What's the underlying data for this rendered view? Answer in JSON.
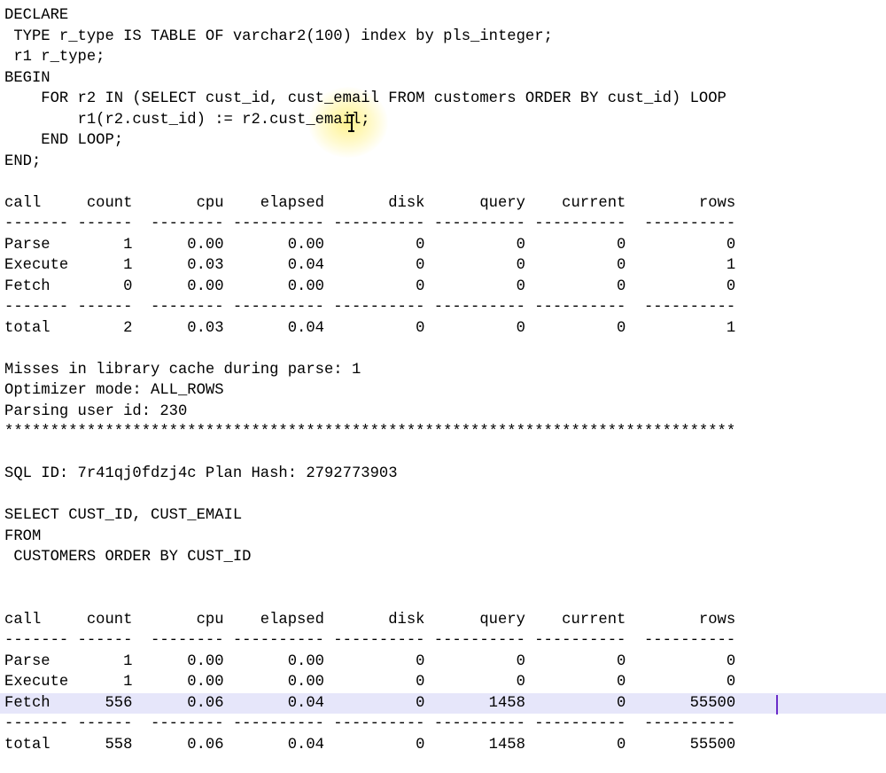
{
  "editor": {
    "lines": [
      "DECLARE",
      " TYPE r_type IS TABLE OF varchar2(100) index by pls_integer;",
      " r1 r_type;",
      "BEGIN",
      "    FOR r2 IN (SELECT cust_id, cust_email FROM customers ORDER BY cust_id) LOOP",
      "        r1(r2.cust_id) := r2.cust_email;",
      "    END LOOP;",
      "END;",
      "",
      "call     count       cpu    elapsed       disk      query    current        rows",
      "------- ------  -------- ---------- ---------- ---------- ----------  ----------",
      "Parse        1      0.00       0.00          0          0          0           0",
      "Execute      1      0.03       0.04          0          0          0           1",
      "Fetch        0      0.00       0.00          0          0          0           0",
      "------- ------  -------- ---------- ---------- ---------- ----------  ----------",
      "total        2      0.03       0.04          0          0          0           1",
      "",
      "Misses in library cache during parse: 1",
      "Optimizer mode: ALL_ROWS",
      "Parsing user id: 230",
      "********************************************************************************",
      "",
      "SQL ID: 7r41qj0fdzj4c Plan Hash: 2792773903",
      "",
      "SELECT CUST_ID, CUST_EMAIL",
      "FROM",
      " CUSTOMERS ORDER BY CUST_ID",
      "",
      "",
      "call     count       cpu    elapsed       disk      query    current        rows",
      "------- ------  -------- ---------- ---------- ---------- ----------  ----------",
      "Parse        1      0.00       0.00          0          0          0           0",
      "Execute      1      0.00       0.00          0          0          0           0",
      "Fetch      556      0.06       0.04          0       1458          0       55500",
      "------- ------  -------- ---------- ---------- ---------- ----------  ----------",
      "total      558      0.06       0.04          0       1458          0       55500"
    ],
    "highlighted_line": 33
  }
}
